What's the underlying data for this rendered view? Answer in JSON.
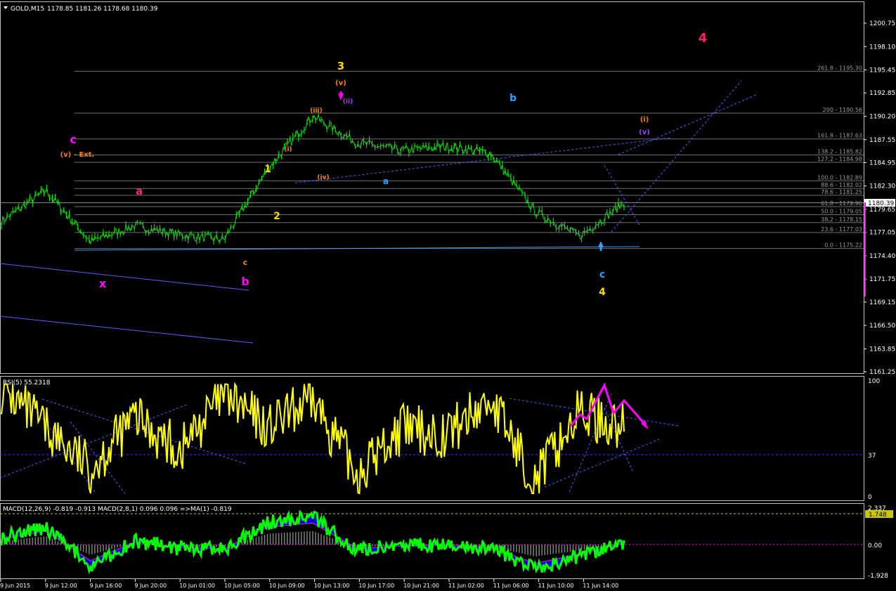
{
  "header": {
    "symbol": "GOLD,M15",
    "ohlc": "1178.85 1181.26 1178.68 1180.39",
    "menu_arrow": "triangle-down-icon"
  },
  "colors": {
    "background": "#000000",
    "grid": "#1a1a1a",
    "fib_line": "#7a7a7a",
    "price_line": "#00ff00",
    "rsi_line": "#ffff00",
    "macd_line": "#00ff00",
    "macd_signal": "#ff00ff",
    "macd_hist": "#0000ff",
    "trend_line": "#5a5aff",
    "orange": "#ff8000",
    "violet": "#a040ff",
    "magenta": "#ff00ff",
    "cyan": "#1ea0ff",
    "yellow": "#ffd800",
    "red": "#ff2040"
  },
  "price_axis": {
    "ticks": [
      "1200.75",
      "1198.10",
      "1195.45",
      "1192.85",
      "1190.20",
      "1187.55",
      "1184.95",
      "1182.30",
      "1179.65",
      "1177.05",
      "1174.40",
      "1171.75",
      "1169.15",
      "1166.50",
      "1163.85",
      "1161.25"
    ],
    "current": "1180.39"
  },
  "time_axis": [
    "9 Jun 2015",
    "9 Jun 12:00",
    "9 Jun 16:00",
    "9 Jun 20:00",
    "10 Jun 01:00",
    "10 Jun 05:00",
    "10 Jun 09:00",
    "10 Jun 13:00",
    "10 Jun 17:00",
    "10 Jun 21:00",
    "11 Jun 02:00",
    "11 Jun 06:00",
    "11 Jun 10:00",
    "11 Jun 14:00"
  ],
  "fib_levels": [
    {
      "label": "261.8 - 1195.30",
      "price": 1195.3
    },
    {
      "label": "200 - 1190.56",
      "price": 1190.56
    },
    {
      "label": "161.8 - 1187.63",
      "price": 1187.63
    },
    {
      "label": "138.2 - 1185.82",
      "price": 1185.82
    },
    {
      "label": "127.2 - 1184.98",
      "price": 1184.98
    },
    {
      "label": "100.0 - 1182.89",
      "price": 1182.89
    },
    {
      "label": "88.6 - 1182.02",
      "price": 1182.02
    },
    {
      "label": "78.6 - 1181.25",
      "price": 1181.25
    },
    {
      "label": "61.8 - 1179.96",
      "price": 1179.96
    },
    {
      "label": "50.0 - 1179.05",
      "price": 1179.05
    },
    {
      "label": "38.2 - 1178.15",
      "price": 1178.15
    },
    {
      "label": "23.6 - 1177.03",
      "price": 1177.03
    },
    {
      "label": "0.0 - 1175.22",
      "price": 1175.22
    }
  ],
  "rsi": {
    "title": "RSI(5) 55.2318",
    "scale": [
      "100",
      "37",
      "0"
    ]
  },
  "macd": {
    "title": "MACD(12,26,9) -0.819 -0.913  MACD(2,8,1) 0.096 0.096  =>MA(1) -0.819",
    "scale": [
      "2.337",
      "1.748",
      "0.00",
      "-1.928"
    ]
  },
  "wave_labels": [
    "4",
    "3",
    "(v)",
    "b",
    "c",
    "a",
    "1",
    "2",
    "c",
    "x",
    "b",
    "(i)",
    "(v)",
    "a",
    "c",
    "4",
    "(ii)",
    "(iii)",
    "(iv)",
    "(i)",
    "(v) - Ext."
  ],
  "chart_data": {
    "type": "line",
    "title": "GOLD,M15",
    "xlabel": "",
    "ylabel": "",
    "ylim": [
      1160.5,
      1202.0
    ],
    "x": [
      "9 Jun 2015",
      "9 Jun 12:00",
      "9 Jun 16:00",
      "9 Jun 20:00",
      "10 Jun 01:00",
      "10 Jun 05:00",
      "10 Jun 09:00",
      "10 Jun 13:00",
      "10 Jun 17:00",
      "10 Jun 21:00",
      "11 Jun 02:00",
      "11 Jun 06:00",
      "11 Jun 10:00",
      "11 Jun 14:00",
      "11 Jun 15:00"
    ],
    "series": [
      {
        "values": [
          1178.3,
          1181.8,
          1176.0,
          1177.8,
          1176.8,
          1176.2,
          1184.3,
          1190.2,
          1187.2,
          1186.3,
          1186.8,
          1186.0,
          1179.4,
          1176.6,
          1180.39
        ]
      }
    ],
    "rsi_values": [
      95,
      60,
      25,
      70,
      40,
      90,
      60,
      85,
      20,
      60,
      55,
      85,
      15,
      75,
      60
    ],
    "macd_values": [
      0.4,
      1.0,
      -1.2,
      0.2,
      -0.2,
      -0.3,
      1.3,
      1.6,
      -0.3,
      -0.1,
      0.0,
      -0.2,
      -1.4,
      -0.7,
      0.1
    ]
  }
}
